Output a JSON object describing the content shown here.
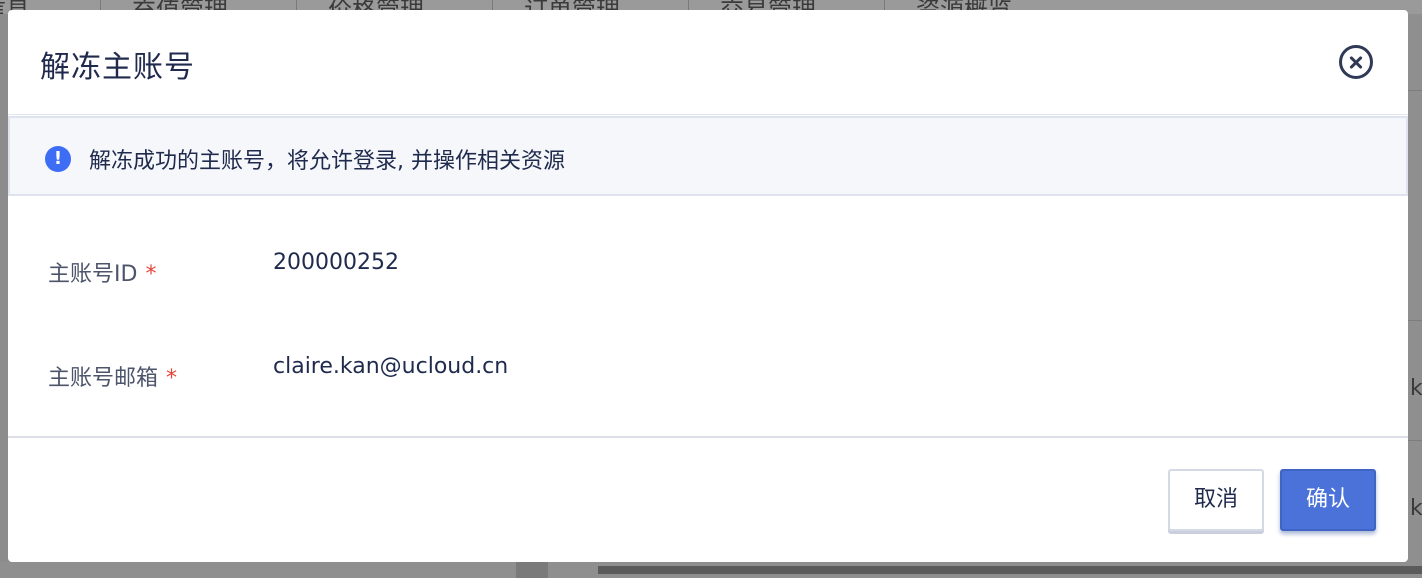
{
  "background": {
    "tabs": [
      "信息",
      "充值管理",
      "价格管理",
      "订单管理",
      "交易管理",
      "资源概览"
    ],
    "right_chars": [
      "k",
      "k"
    ]
  },
  "modal": {
    "title": "解冻主账号",
    "notice": "解冻成功的主账号，将允许登录, 并操作相关资源",
    "fields": [
      {
        "label": "主账号ID",
        "required_mark": "*",
        "value": "200000252"
      },
      {
        "label": "主账号邮箱",
        "required_mark": "*",
        "value": "claire.kan@ucloud.cn"
      }
    ],
    "cancel_label": "取消",
    "confirm_label": "确认"
  },
  "colors": {
    "primary": "#4a72d9",
    "info_icon": "#3e6df5",
    "required": "#e5453b",
    "text": "#1f2a4d"
  },
  "icons": {
    "close": "close-circle-icon",
    "info": "exclamation-circle-icon"
  }
}
